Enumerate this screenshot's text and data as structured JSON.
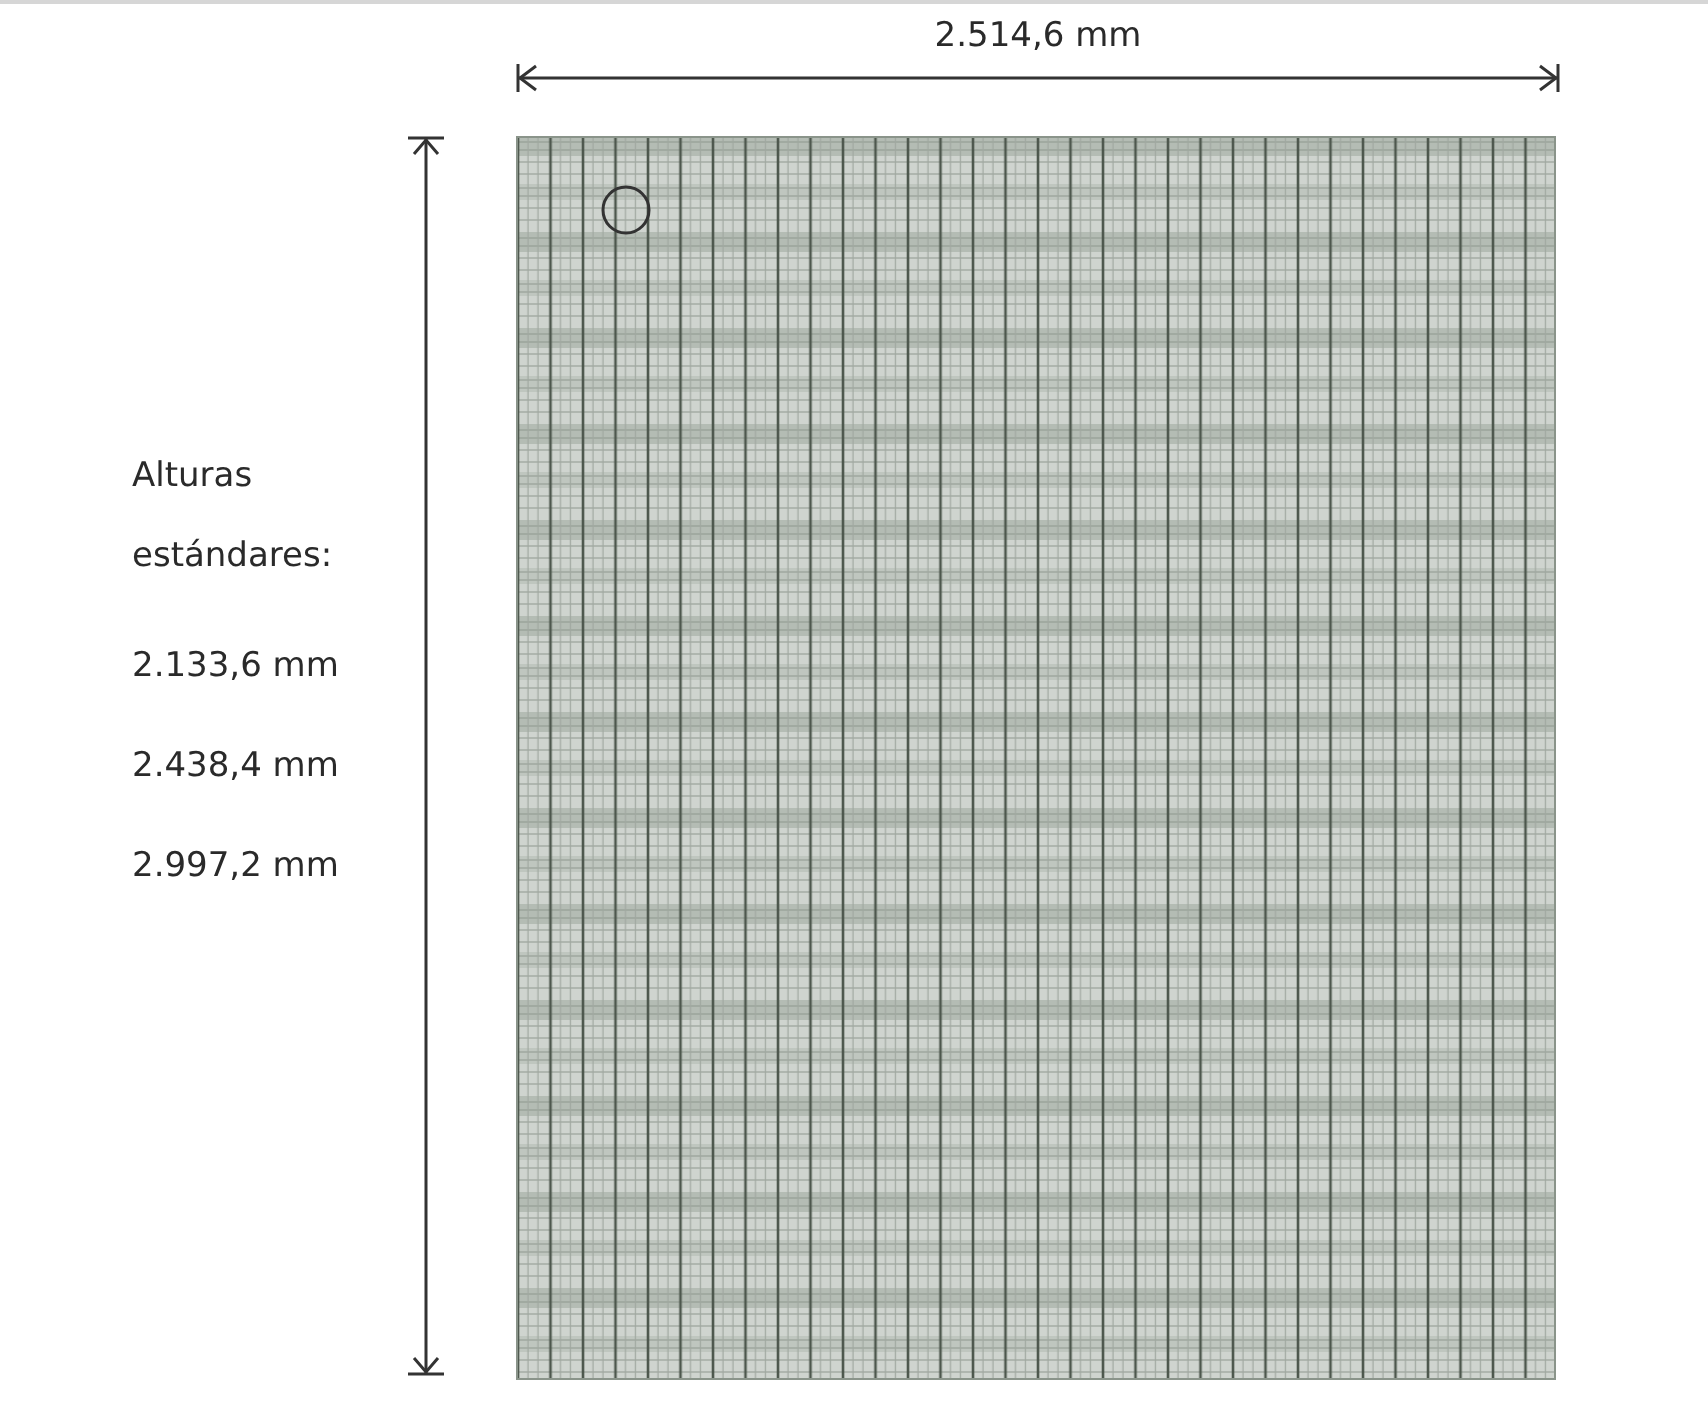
{
  "width_dimension": {
    "label": "2.514,6 mm"
  },
  "height_info": {
    "title": "Alturas estándares:",
    "values": [
      "2.133,6 mm",
      "2.438,4 mm",
      "2.997,2 mm"
    ]
  }
}
